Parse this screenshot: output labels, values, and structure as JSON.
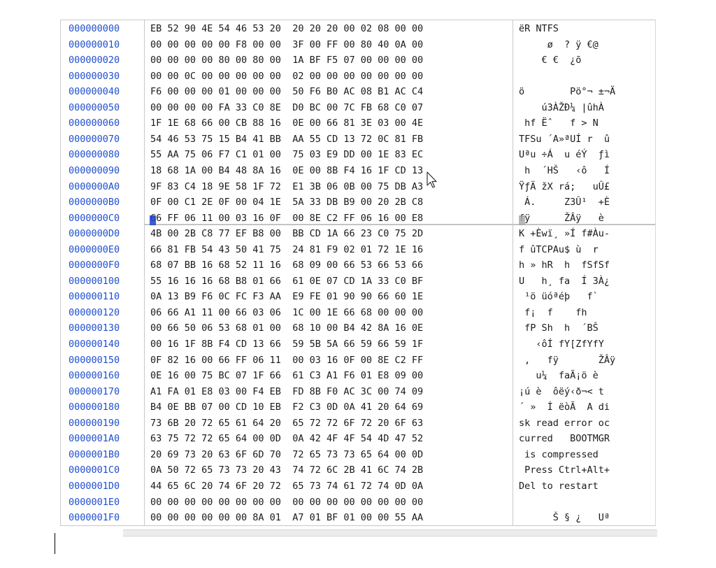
{
  "hex_view": {
    "rows": [
      {
        "offset": "000000000",
        "hex": "EB 52 90 4E 54 46 53 20  20 20 20 00 02 08 00 00",
        "ascii": "ëR NTFS"
      },
      {
        "offset": "000000010",
        "hex": "00 00 00 00 00 F8 00 00  3F 00 FF 00 80 40 0A 00",
        "ascii": "     ø  ? ÿ €@"
      },
      {
        "offset": "000000020",
        "hex": "00 00 00 00 80 00 80 00  1A BF F5 07 00 00 00 00",
        "ascii": "    € €  ¿õ"
      },
      {
        "offset": "000000030",
        "hex": "00 00 0C 00 00 00 00 00  02 00 00 00 00 00 00 00",
        "ascii": ""
      },
      {
        "offset": "000000040",
        "hex": "F6 00 00 00 01 00 00 00  50 F6 B0 AC 08 B1 AC C4",
        "ascii": "ö        Pö°¬ ±¬Ä"
      },
      {
        "offset": "000000050",
        "hex": "00 00 00 00 FA 33 C0 8E  D0 BC 00 7C FB 68 C0 07",
        "ascii": "    ú3ÀŽÐ¼ |ûhÀ"
      },
      {
        "offset": "000000060",
        "hex": "1F 1E 68 66 00 CB 88 16  0E 00 66 81 3E 03 00 4E",
        "ascii": " hf Ëˆ   f > N"
      },
      {
        "offset": "000000070",
        "hex": "54 46 53 75 15 B4 41 BB  AA 55 CD 13 72 0C 81 FB",
        "ascii": "TFSu ´A»ªUÍ r  û"
      },
      {
        "offset": "000000080",
        "hex": "55 AA 75 06 F7 C1 01 00  75 03 E9 DD 00 1E 83 EC",
        "ascii": "Uªu ÷Á  u éÝ  ƒì"
      },
      {
        "offset": "000000090",
        "hex": "18 68 1A 00 B4 48 8A 16  0E 00 8B F4 16 1F CD 13",
        "ascii": " h  ´HŠ   ‹ô   Í"
      },
      {
        "offset": "0000000A0",
        "hex": "9F 83 C4 18 9E 58 1F 72  E1 3B 06 0B 00 75 DB A3",
        "ascii": "ŸƒÄ žX rá;   uÛ£"
      },
      {
        "offset": "0000000B0",
        "hex": "0F 00 C1 2E 0F 00 04 1E  5A 33 DB B9 00 20 2B C8",
        "ascii": " Á.     Z3Û¹  +È"
      },
      {
        "offset": "0000000C0",
        "hex": "66 FF 06 11 00 03 16 0F  00 8E C2 FF 06 16 00 E8",
        "ascii": "fÿ      ŽÂÿ   è"
      },
      {
        "offset": "0000000D0",
        "hex": "4B 00 2B C8 77 EF B8 00  BB CD 1A 66 23 C0 75 2D",
        "ascii": "K +Èwï¸ »Í f#Àu-"
      },
      {
        "offset": "0000000E0",
        "hex": "66 81 FB 54 43 50 41 75  24 81 F9 02 01 72 1E 16",
        "ascii": "f ûTCPAu$ ù  r"
      },
      {
        "offset": "0000000F0",
        "hex": "68 07 BB 16 68 52 11 16  68 09 00 66 53 66 53 66",
        "ascii": "h » hR  h  fSfSf"
      },
      {
        "offset": "000000100",
        "hex": "55 16 16 16 68 B8 01 66  61 0E 07 CD 1A 33 C0 BF",
        "ascii": "U   h¸ fa  Í 3À¿"
      },
      {
        "offset": "000000110",
        "hex": "0A 13 B9 F6 0C FC F3 AA  E9 FE 01 90 90 66 60 1E",
        "ascii": " ¹ö üóªéþ   f`"
      },
      {
        "offset": "000000120",
        "hex": "06 66 A1 11 00 66 03 06  1C 00 1E 66 68 00 00 00",
        "ascii": " f¡  f    fh"
      },
      {
        "offset": "000000130",
        "hex": "00 66 50 06 53 68 01 00  68 10 00 B4 42 8A 16 0E",
        "ascii": " fP Sh  h  ´BŠ"
      },
      {
        "offset": "000000140",
        "hex": "00 16 1F 8B F4 CD 13 66  59 5B 5A 66 59 66 59 1F",
        "ascii": "   ‹ôÍ fY[ZfYfY"
      },
      {
        "offset": "000000150",
        "hex": "0F 82 16 00 66 FF 06 11  00 03 16 0F 00 8E C2 FF",
        "ascii": " ,   fÿ       ŽÂÿ"
      },
      {
        "offset": "000000160",
        "hex": "0E 16 00 75 BC 07 1F 66  61 C3 A1 F6 01 E8 09 00",
        "ascii": "   u¼  faÃ¡ö è"
      },
      {
        "offset": "000000170",
        "hex": "A1 FA 01 E8 03 00 F4 EB  FD 8B F0 AC 3C 00 74 09",
        "ascii": "¡ú è  ôëý‹ð¬< t"
      },
      {
        "offset": "000000180",
        "hex": "B4 0E BB 07 00 CD 10 EB  F2 C3 0D 0A 41 20 64 69",
        "ascii": "´ »  Í ëòÃ  A di"
      },
      {
        "offset": "000000190",
        "hex": "73 6B 20 72 65 61 64 20  65 72 72 6F 72 20 6F 63",
        "ascii": "sk read error oc"
      },
      {
        "offset": "0000001A0",
        "hex": "63 75 72 72 65 64 00 0D  0A 42 4F 4F 54 4D 47 52",
        "ascii": "curred   BOOTMGR"
      },
      {
        "offset": "0000001B0",
        "hex": "20 69 73 20 63 6F 6D 70  72 65 73 73 65 64 00 0D",
        "ascii": " is compressed"
      },
      {
        "offset": "0000001C0",
        "hex": "0A 50 72 65 73 73 20 43  74 72 6C 2B 41 6C 74 2B",
        "ascii": " Press Ctrl+Alt+"
      },
      {
        "offset": "0000001D0",
        "hex": "44 65 6C 20 74 6F 20 72  65 73 74 61 72 74 0D 0A",
        "ascii": "Del to restart"
      },
      {
        "offset": "0000001E0",
        "hex": "00 00 00 00 00 00 00 00  00 00 00 00 00 00 00 00",
        "ascii": ""
      },
      {
        "offset": "0000001F0",
        "hex": "00 00 00 00 00 00 8A 01  A7 01 BF 01 00 00 55 AA",
        "ascii": "      Š § ¿   Uª"
      }
    ]
  },
  "colors": {
    "offset_text": "#1f4fd0",
    "data_text": "#1a1a1a",
    "selection_caret": "#1f3fcc",
    "divider": "#c8c8c8"
  },
  "icons": {
    "mouse_cursor": "arrow-pointer-icon"
  }
}
